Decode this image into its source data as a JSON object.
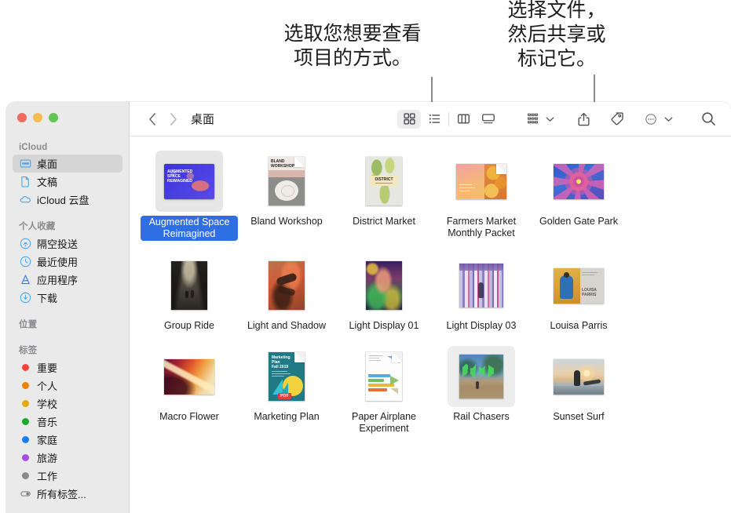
{
  "callouts": {
    "view_hint": "选取您想要查看\n项目的方式。",
    "share_hint": "选择文件，\n然后共享或\n标记它。"
  },
  "window": {
    "traffic_lights": {
      "close": "close-button",
      "minimize": "minimize-button",
      "maximize": "maximize-button"
    }
  },
  "sidebar": {
    "sections": [
      {
        "title": "iCloud",
        "items": [
          {
            "label": "桌面",
            "icon": "desktop-icon",
            "selected": true
          },
          {
            "label": "文稿",
            "icon": "document-icon",
            "selected": false
          },
          {
            "label": "iCloud 云盘",
            "icon": "cloud-icon",
            "selected": false
          }
        ]
      },
      {
        "title": "个人收藏",
        "items": [
          {
            "label": "隔空投送",
            "icon": "airdrop-icon",
            "selected": false
          },
          {
            "label": "最近使用",
            "icon": "clock-icon",
            "selected": false
          },
          {
            "label": "应用程序",
            "icon": "applications-icon",
            "selected": false
          },
          {
            "label": "下载",
            "icon": "downloads-icon",
            "selected": false
          }
        ]
      },
      {
        "title": "位置",
        "items": []
      },
      {
        "title": "标签",
        "items": [
          {
            "label": "重要",
            "icon": "tag-dot-red",
            "color": "#f3453c",
            "selected": false
          },
          {
            "label": "个人",
            "icon": "tag-dot-orange",
            "color": "#ee8000",
            "selected": false
          },
          {
            "label": "学校",
            "icon": "tag-dot-yellow",
            "color": "#e3ab10",
            "selected": false
          },
          {
            "label": "音乐",
            "icon": "tag-dot-green",
            "color": "#15ac2b",
            "selected": false
          },
          {
            "label": "家庭",
            "icon": "tag-dot-blue",
            "color": "#157df7",
            "selected": false
          },
          {
            "label": "旅游",
            "icon": "tag-dot-purple",
            "color": "#a550e3",
            "selected": false
          },
          {
            "label": "工作",
            "icon": "tag-dot-gray",
            "color": "#8a8a8e",
            "selected": false
          },
          {
            "label": "所有标签...",
            "icon": "all-tags-icon",
            "selected": false
          }
        ]
      }
    ]
  },
  "toolbar": {
    "back": "后退",
    "forward": "前进",
    "path_label": "桌面",
    "views": [
      {
        "name": "icon-view",
        "label": "图标显示",
        "active": true
      },
      {
        "name": "list-view",
        "label": "列表显示",
        "active": false
      },
      {
        "name": "column-view",
        "label": "分栏显示",
        "active": false
      },
      {
        "name": "gallery-view",
        "label": "画廊显示",
        "active": false
      }
    ],
    "group_label": "分组方式",
    "share_label": "共享",
    "tag_label": "标记",
    "more_label": "更多",
    "search_label": "搜索"
  },
  "files": [
    {
      "name": "Augmented Space Reimagined",
      "kind": "image-thumb",
      "shape": "landscape",
      "selected": true
    },
    {
      "name": "Bland Workshop",
      "kind": "doc-thumb",
      "shape": "portrait",
      "selected": false
    },
    {
      "name": "District Market",
      "kind": "image-thumb",
      "shape": "portrait",
      "selected": false
    },
    {
      "name": "Farmers Market Monthly Packet",
      "kind": "doc-thumb",
      "shape": "landscape",
      "selected": false
    },
    {
      "name": "Golden Gate Park",
      "kind": "image-thumb",
      "shape": "landscape",
      "selected": false
    },
    {
      "name": "Group Ride",
      "kind": "image-thumb",
      "shape": "portrait",
      "selected": false
    },
    {
      "name": "Light and Shadow",
      "kind": "image-thumb",
      "shape": "portrait",
      "selected": false
    },
    {
      "name": "Light Display 01",
      "kind": "image-thumb",
      "shape": "portrait",
      "selected": false
    },
    {
      "name": "Light Display 03",
      "kind": "image-thumb",
      "shape": "square",
      "selected": false
    },
    {
      "name": "Louisa Parris",
      "kind": "image-thumb",
      "shape": "landscape",
      "selected": false
    },
    {
      "name": "Macro Flower",
      "kind": "image-thumb",
      "shape": "landscape",
      "selected": false
    },
    {
      "name": "Marketing Plan",
      "kind": "pdf-thumb",
      "shape": "portrait",
      "selected": false
    },
    {
      "name": "Paper Airplane Experiment",
      "kind": "doc-thumb",
      "shape": "portrait",
      "selected": false
    },
    {
      "name": "Rail Chasers",
      "kind": "image-thumb",
      "shape": "square",
      "selected": false
    },
    {
      "name": "Sunset Surf",
      "kind": "image-thumb",
      "shape": "landscape",
      "selected": false
    }
  ],
  "colors": {
    "selection_blue": "#2f6fe4",
    "sidebar_bg": "#ebeaea",
    "sidebar_selected": "#d6d5d5",
    "callout_line": "#8a8a8a",
    "text": "#1d1d1f"
  }
}
